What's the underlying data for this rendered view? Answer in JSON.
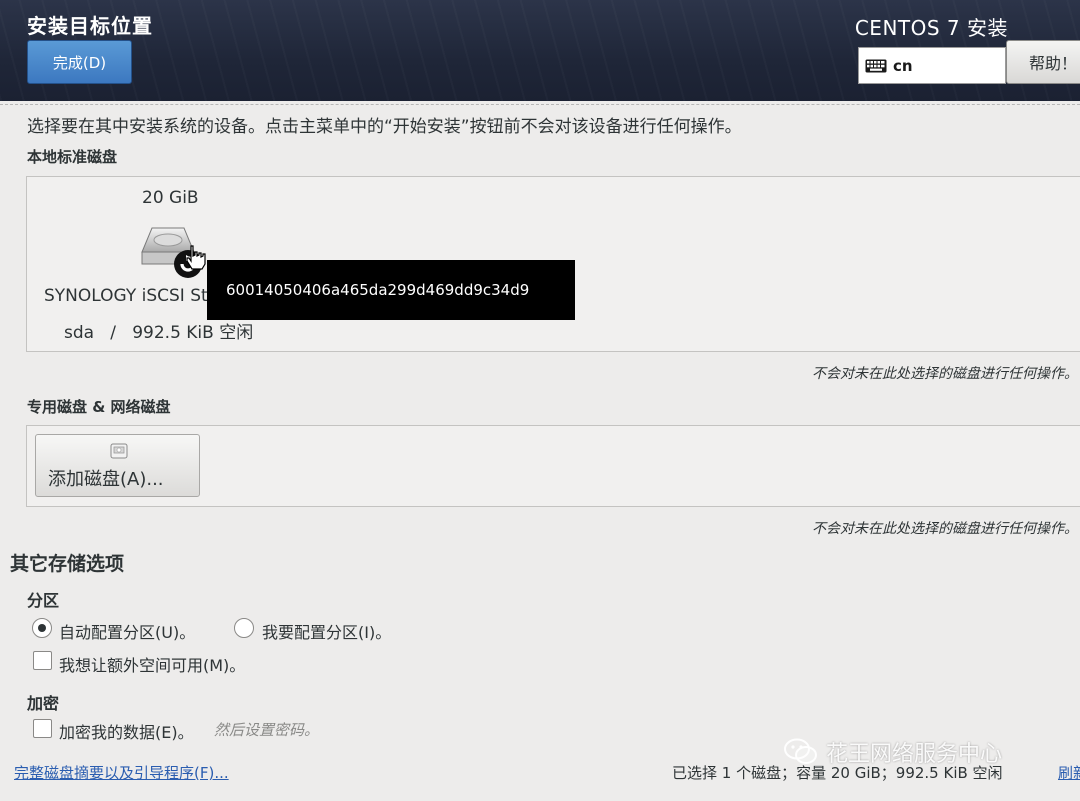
{
  "header": {
    "spoke_title": "安装目标位置",
    "done_label": "完成(D)",
    "product_title": "CENTOS 7 安装",
    "keyboard_layout": "cn",
    "help_label": "帮助！"
  },
  "intro_text": "选择要在其中安装系统的设备。点击主菜单中的“开始安装”按钮前不会对该设备进行任何操作。",
  "local_disks": {
    "heading": "本地标准磁盘",
    "disks": [
      {
        "size": "20 GiB",
        "name": "SYNOLOGY iSCSI Storage",
        "device": "sda   /   992.5 KiB 空闲",
        "tooltip": "60014050406a465da299d469dd9c34d9"
      }
    ],
    "note": "不会对未在此处选择的磁盘进行任何操作。"
  },
  "specialized_disks": {
    "heading": "专用磁盘 & 网络磁盘",
    "add_button_label": "添加磁盘(A)...",
    "note": "不会对未在此处选择的磁盘进行任何操作。"
  },
  "other_storage": {
    "heading": "其它存储选项",
    "partitioning": {
      "heading": "分区",
      "auto_label": "自动配置分区(U)。",
      "manual_label": "我要配置分区(I)。",
      "selected": "auto",
      "extra_space_label": "我想让额外空间可用(M)。",
      "extra_space_checked": false
    },
    "encryption": {
      "heading": "加密",
      "encrypt_label": "加密我的数据(E)。",
      "encrypt_checked": false,
      "hint": "然后设置密码。"
    }
  },
  "footer": {
    "summary_link": "完整磁盘摘要以及引导程序(F)...",
    "status": "已选择 1 个磁盘；容量 20 GiB；992.5 KiB 空闲",
    "refresh_label": "刷新"
  },
  "watermark": {
    "text": "花王网络服务中心"
  },
  "colors": {
    "header_bg": "#1f2638",
    "accent_blue": "#3c78c0",
    "link": "#2a5db0",
    "page_bg": "#edeceb"
  }
}
